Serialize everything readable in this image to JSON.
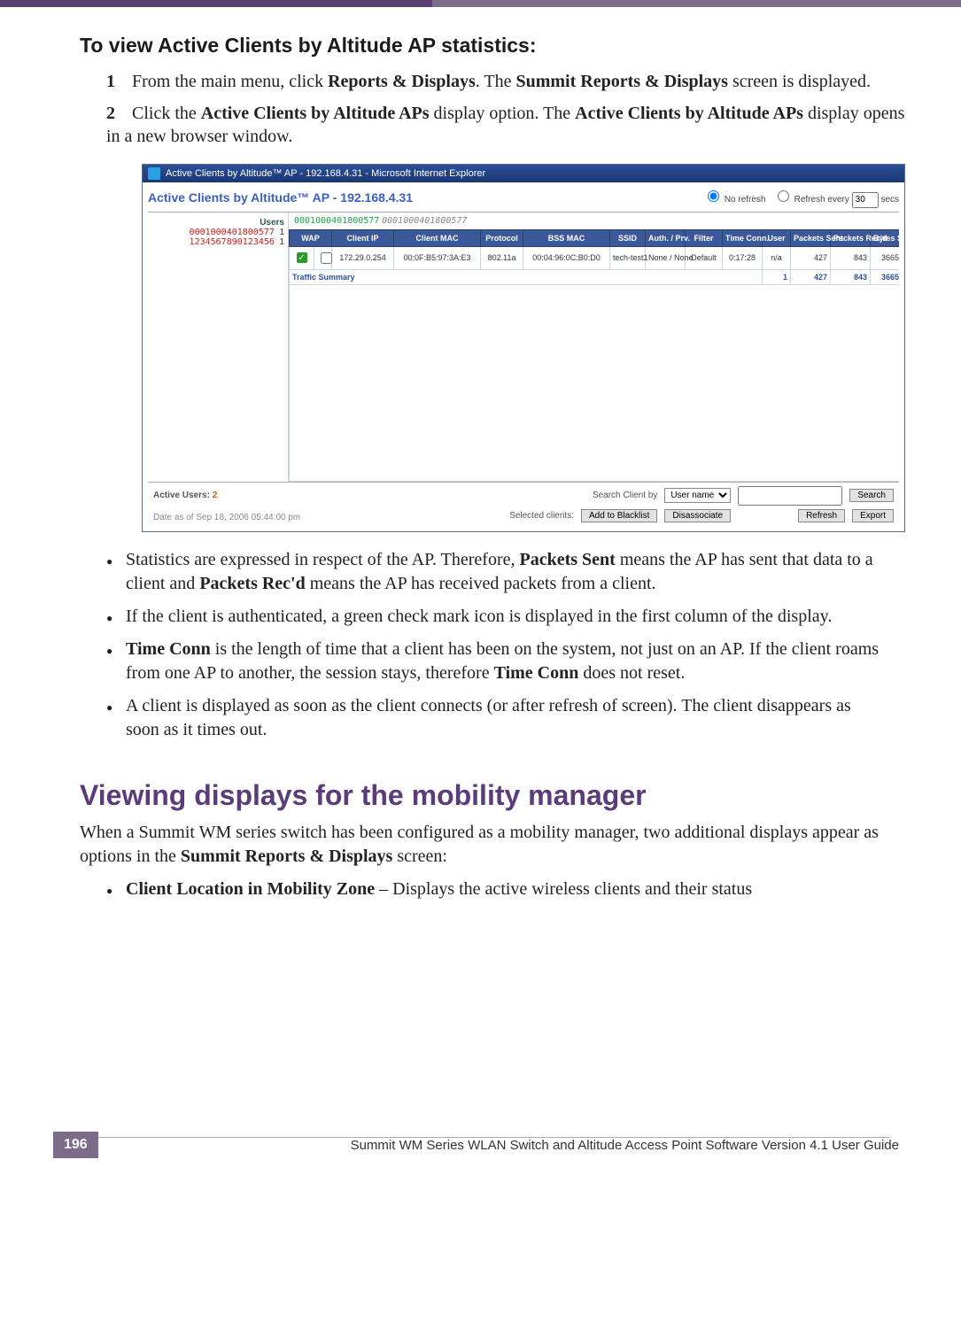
{
  "section_title": "To view Active Clients by Altitude AP statistics:",
  "steps": [
    {
      "num": "1",
      "prefix": "From the main menu, click ",
      "bold1": "Reports & Displays",
      "mid": ". The ",
      "bold2": "Summit Reports & Displays",
      "suffix": " screen is displayed."
    },
    {
      "num": "2",
      "prefix": "Click the ",
      "bold1": "Active Clients by Altitude APs",
      "mid": " display option. The ",
      "bold2": "Active Clients by Altitude APs",
      "suffix": " display opens in a new browser window."
    }
  ],
  "fig": {
    "window_title": "Active Clients by Altitude™ AP - 192.168.4.31 - Microsoft Internet Explorer",
    "page_title": "Active Clients by Altitude™ AP - 192.168.4.31",
    "refresh": {
      "no_refresh": "No refresh",
      "refresh_every": "Refresh every",
      "value": "30",
      "secs": "secs"
    },
    "users_label": "Users",
    "left_users": [
      {
        "mac": "0001000401800577",
        "count": "1"
      },
      {
        "mac": "1234567890123456",
        "count": "1"
      }
    ],
    "maclist": {
      "bold": "0001000401800577",
      "ital": "0001000401800577"
    },
    "headers": [
      "WAP",
      "Client IP",
      "Client MAC",
      "Protocol",
      "BSS MAC",
      "SSID",
      "Auth. / Prv.",
      "Filter",
      "Time Conn.",
      "User",
      "Packets Sent",
      "Packets Rec'd",
      "Bytes Sent"
    ],
    "row": {
      "wap": "✓",
      "chk": "☐",
      "client_ip": "172.29.0.254",
      "client_mac": "00:0F:B5:97:3A:E3",
      "protocol": "802.11a",
      "bss_mac": "00:04:96:0C:B0:D0",
      "ssid": "tech-test1",
      "auth": "None / None",
      "filter": "Default",
      "time": "0:17:28",
      "user": "n/a",
      "psent": "427",
      "precd": "843",
      "bsent": "3665"
    },
    "summary": {
      "label": "Traffic Summary",
      "count": "1",
      "psent": "427",
      "precd": "843",
      "bsent": "3665"
    },
    "bottom": {
      "active_users_label": "Active Users:",
      "active_users_count": "2",
      "search_label": "Search Client by",
      "search_mode": "User name",
      "search_btn": "Search",
      "selected_label": "Selected clients:",
      "blacklist_btn": "Add to Blacklist",
      "disassoc_btn": "Disassociate",
      "refresh_btn": "Refresh",
      "export_btn": "Export",
      "date": "Date as of Sep 18, 2006 05:44:00 pm"
    }
  },
  "bullets1": [
    {
      "t1": "Statistics are expressed in respect of the AP. Therefore, ",
      "b1": "Packets Sent",
      "t2": " means the AP has sent that data to a client and ",
      "b2": "Packets Rec'd",
      "t3": " means the AP has received packets from a client."
    },
    {
      "t1": "If the client is authenticated, a green check mark icon is displayed in the first column of the display."
    },
    {
      "b1": "Time Conn",
      "t1": " is the length of time that a client has been on the system, not just on an AP. If the client roams from one AP to another, the session stays, therefore ",
      "b2": "Time Conn",
      "t2": " does not reset."
    },
    {
      "t1": "A client is displayed as soon as the client connects (or after refresh of screen). The client disappears as soon as it times out."
    }
  ],
  "subh2": "Viewing displays for the mobility manager",
  "para2a": "When a Summit WM series switch has been configured as a mobility manager, two additional displays appear as options in the ",
  "para2b": "Summit Reports & Displays",
  "para2c": " screen:",
  "bullets2": [
    {
      "b1": "Client Location in Mobility Zone",
      "t1": " – Displays the active wireless clients and their status"
    }
  ],
  "footer": {
    "page": "196",
    "guide": "Summit WM Series WLAN Switch and Altitude Access Point Software Version 4.1 User Guide"
  }
}
